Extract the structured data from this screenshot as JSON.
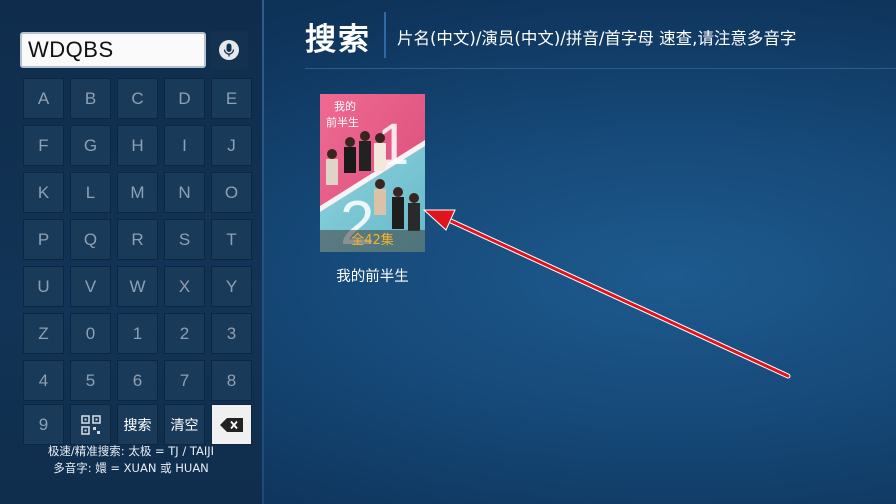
{
  "search": {
    "query": "WDQBS"
  },
  "keyboard": {
    "rows": [
      [
        "A",
        "B",
        "C",
        "D",
        "E"
      ],
      [
        "F",
        "G",
        "H",
        "I",
        "J"
      ],
      [
        "K",
        "L",
        "M",
        "N",
        "O"
      ],
      [
        "P",
        "Q",
        "R",
        "S",
        "T"
      ],
      [
        "U",
        "V",
        "W",
        "X",
        "Y"
      ],
      [
        "Z",
        "0",
        "1",
        "2",
        "3"
      ],
      [
        "4",
        "5",
        "6",
        "7",
        "8"
      ]
    ],
    "last_row": {
      "key_9": "9",
      "search_label": "搜索",
      "clear_label": "清空"
    }
  },
  "hints": {
    "line1": "极速/精准搜索: 太极 = TJ / TAIJI",
    "line2": "多音字: 嬛 = XUAN 或 HUAN"
  },
  "header": {
    "title": "搜索",
    "instructions": "片名(中文)/演员(中文)/拼音/首字母 速查,请注意多音字"
  },
  "results": [
    {
      "title": "我的前半生",
      "badge": "全42集",
      "poster_title": "我的前半生"
    }
  ],
  "icons": {
    "mic": "microphone-icon",
    "qr": "qr-code-icon",
    "backspace": "backspace-icon"
  },
  "colors": {
    "key_bg": "#1a3a5a",
    "badge_text": "#f7b32b",
    "arrow": "#e0141c"
  }
}
